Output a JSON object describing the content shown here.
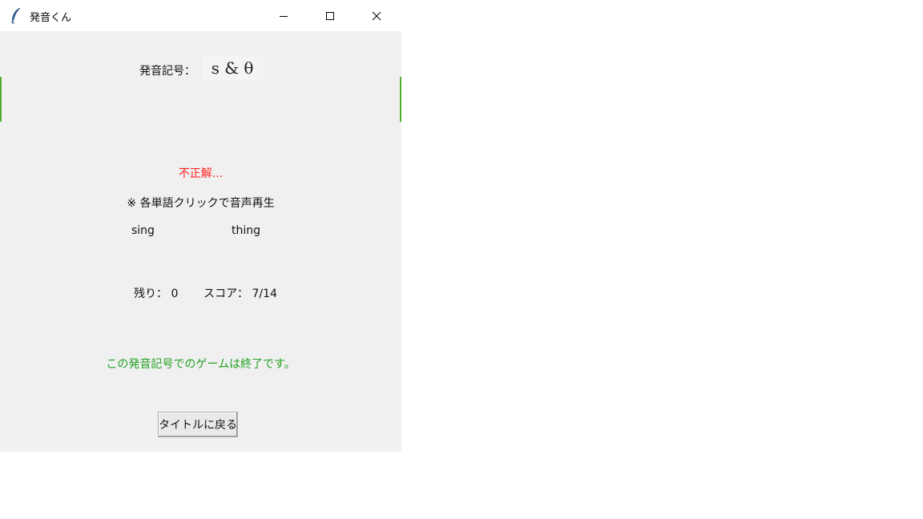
{
  "window": {
    "title": "発音くん",
    "icon": "feather-icon",
    "controls": [
      "minimize-icon",
      "maximize-icon",
      "close-icon"
    ]
  },
  "phonetic": {
    "label": "発音記号：",
    "symbol": "s & θ"
  },
  "result_text": "不正解...",
  "hint_text": "※ 各単語クリックで音声再生",
  "words": [
    "sing",
    "thing"
  ],
  "remaining": "残り： 0",
  "score": "スコア： 7/14",
  "finished_text": "この発音記号でのゲームは終了です。",
  "back_button_label": "タイトルに戻る",
  "colors": {
    "result": "#ff2020",
    "finished": "#22a022",
    "background": "#f0f0f0"
  }
}
